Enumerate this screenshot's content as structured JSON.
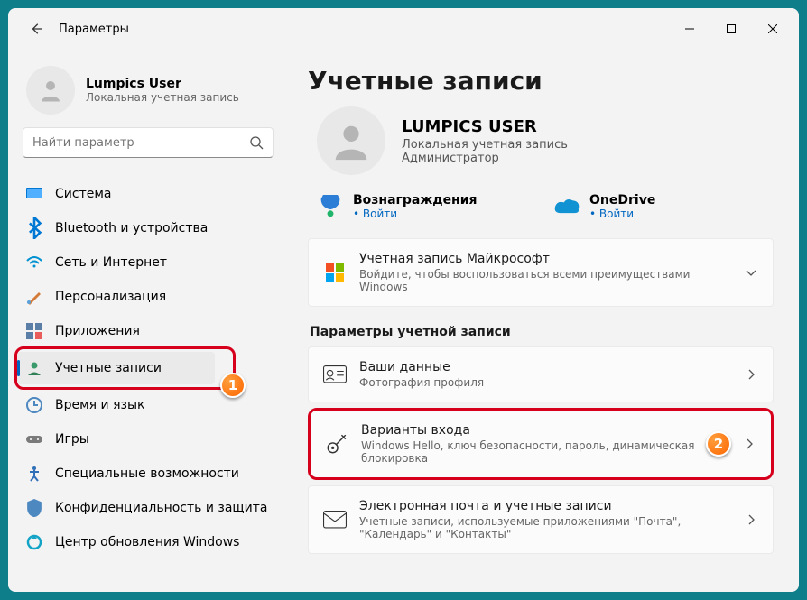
{
  "app": {
    "title": "Параметры"
  },
  "profile": {
    "name": "Lumpics User",
    "subtitle": "Локальная учетная запись"
  },
  "search": {
    "placeholder": "Найти параметр"
  },
  "nav": {
    "items": [
      {
        "label": "Система"
      },
      {
        "label": "Bluetooth и устройства"
      },
      {
        "label": "Сеть и Интернет"
      },
      {
        "label": "Персонализация"
      },
      {
        "label": "Приложения"
      },
      {
        "label": "Учетные записи"
      },
      {
        "label": "Время и язык"
      },
      {
        "label": "Игры"
      },
      {
        "label": "Специальные возможности"
      },
      {
        "label": "Конфиденциальность и защита"
      },
      {
        "label": "Центр обновления Windows"
      }
    ]
  },
  "main": {
    "title": "Учетные записи",
    "account": {
      "name": "LUMPICS USER",
      "subtitle": "Локальная учетная запись",
      "role": "Администратор"
    },
    "quick": {
      "rewards": {
        "title": "Вознаграждения",
        "action": "Войти"
      },
      "onedrive": {
        "title": "OneDrive",
        "action": "Войти"
      }
    },
    "msaccount": {
      "title": "Учетная запись Майкрософт",
      "sub": "Войдите, чтобы воспользоваться всеми преимуществами Windows"
    },
    "section_label": "Параметры учетной записи",
    "cards": {
      "your_info": {
        "title": "Ваши данные",
        "sub": "Фотография профиля"
      },
      "signin": {
        "title": "Варианты входа",
        "sub": "Windows Hello, ключ безопасности, пароль, динамическая блокировка"
      },
      "email": {
        "title": "Электронная почта и учетные записи",
        "sub": "Учетные записи, используемые приложениями \"Почта\", \"Календарь\" и \"Контакты\""
      }
    },
    "annotations": {
      "badge1": "1",
      "badge2": "2"
    }
  }
}
